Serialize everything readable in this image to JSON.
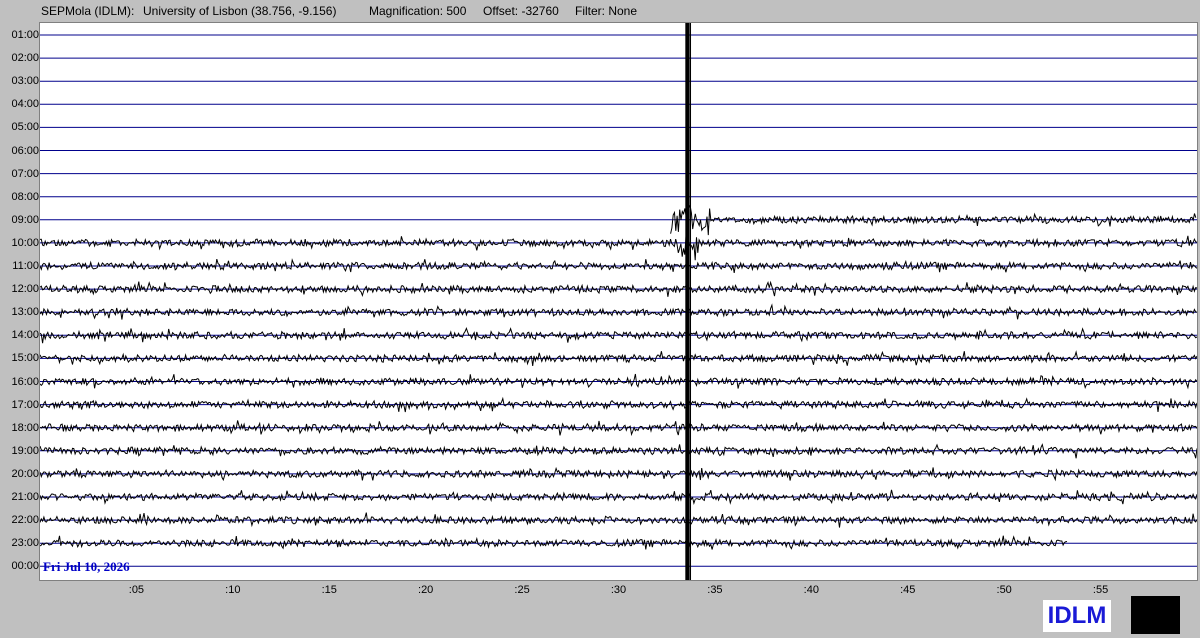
{
  "header": {
    "station": "SEPMola (IDLM):",
    "location": "University of Lisbon (38.756, -9.156)",
    "magnification": "Magnification: 500",
    "offset": "Offset: -32760",
    "filter": "Filter: None"
  },
  "date_label": "Fri Jul 10, 2026",
  "station_code": "IDLM",
  "colors": {
    "background": "#c0c0c0",
    "plot_background": "#ffffff",
    "hour_lines": "#00008b",
    "trace": "#000000",
    "date_text": "#0000c8",
    "station_text": "#1a1ad6"
  },
  "chart_data": {
    "type": "line",
    "hour_labels": [
      "01:00",
      "02:00",
      "03:00",
      "04:00",
      "05:00",
      "06:00",
      "07:00",
      "08:00",
      "09:00",
      "10:00",
      "11:00",
      "12:00",
      "13:00",
      "14:00",
      "15:00",
      "16:00",
      "17:00",
      "18:00",
      "19:00",
      "20:00",
      "21:00",
      "22:00",
      "23:00",
      "00:00"
    ],
    "minute_labels": [
      ":05",
      ":10",
      ":15",
      ":20",
      ":25",
      ":30",
      ":35",
      ":40",
      ":45",
      ":50",
      ":55"
    ],
    "minute_ticks": [
      5,
      10,
      15,
      20,
      25,
      30,
      35,
      40,
      45,
      50,
      55
    ],
    "xlim": [
      0,
      60
    ],
    "trace_start": {
      "hour_index": 8,
      "minute": 32.7
    },
    "trace_end": {
      "hour_index": 22,
      "minute": 53.3
    },
    "event": {
      "minute": 33.6,
      "label": ""
    },
    "grid": true
  }
}
